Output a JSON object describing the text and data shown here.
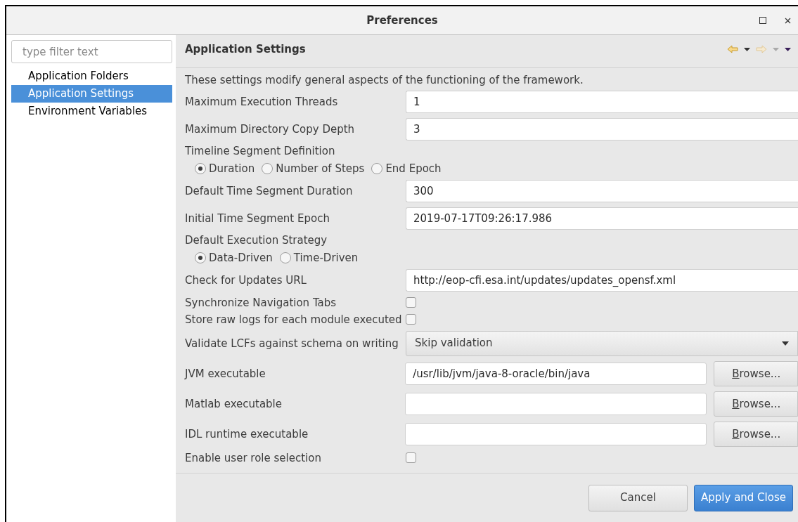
{
  "window": {
    "title": "Preferences"
  },
  "filter": {
    "placeholder": "type filter text"
  },
  "sidebar": {
    "items": [
      {
        "label": "Application Folders",
        "selected": false
      },
      {
        "label": "Application Settings",
        "selected": true
      },
      {
        "label": "Environment Variables",
        "selected": false
      }
    ]
  },
  "page": {
    "title": "Application Settings",
    "description": "These settings modify general aspects of the functioning of the framework."
  },
  "settings": [
    {
      "kind": "text",
      "label": "Maximum Execution Threads",
      "value": "1"
    },
    {
      "kind": "text",
      "label": "Maximum Directory Copy Depth",
      "value": "3"
    },
    {
      "kind": "radio",
      "label": "Timeline Segment Definition",
      "options": [
        {
          "label": "Duration",
          "selected": true
        },
        {
          "label": "Number of Steps",
          "selected": false
        },
        {
          "label": "End Epoch",
          "selected": false
        }
      ]
    },
    {
      "kind": "text",
      "label": "Default Time Segment Duration",
      "value": "300"
    },
    {
      "kind": "text",
      "label": "Initial Time Segment Epoch",
      "value": "2019-07-17T09:26:17.986"
    },
    {
      "kind": "radio",
      "label": "Default Execution Strategy",
      "options": [
        {
          "label": "Data-Driven",
          "selected": true
        },
        {
          "label": "Time-Driven",
          "selected": false
        }
      ]
    },
    {
      "kind": "text",
      "label": "Check for Updates URL",
      "value": "http://eop-cfi.esa.int/updates/updates_opensf.xml"
    },
    {
      "kind": "checkbox",
      "label": "Synchronize Navigation Tabs",
      "checked": false
    },
    {
      "kind": "checkbox",
      "label": "Store raw logs for each module executed",
      "checked": false
    },
    {
      "kind": "select",
      "label": "Validate LCFs against schema on writing",
      "value": "Skip validation"
    },
    {
      "kind": "file",
      "label": "JVM executable",
      "value": "/usr/lib/jvm/java-8-oracle/bin/java",
      "button": "Browse..."
    },
    {
      "kind": "file",
      "label": "Matlab executable",
      "button": "Browse..."
    },
    {
      "kind": "file",
      "label": "IDL runtime executable",
      "button": "Browse..."
    },
    {
      "kind": "checkbox",
      "label": "Enable user role selection",
      "checked": false
    }
  ],
  "buttons": [
    {
      "label": "Cancel",
      "kind": "secondary"
    },
    {
      "label": "Apply and Close",
      "kind": "primary"
    }
  ]
}
